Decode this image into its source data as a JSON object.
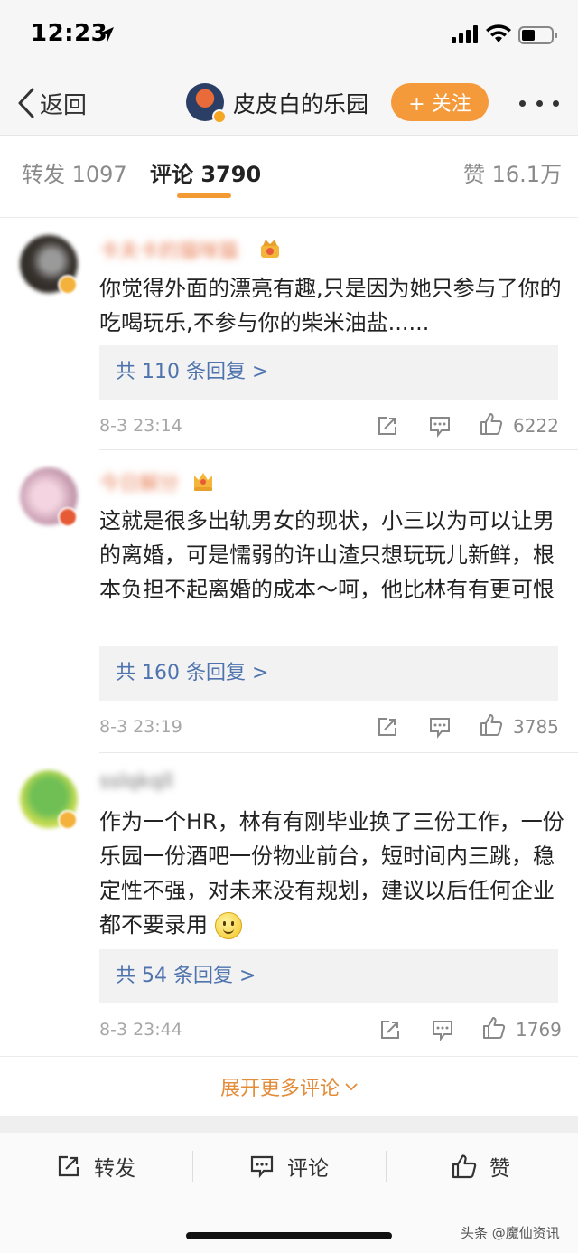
{
  "status_bar": {
    "time": "12:23"
  },
  "nav": {
    "back_label": "返回",
    "title": "皮皮白的乐园",
    "follow_label": "+ 关注"
  },
  "tabs": {
    "repost": "转发 1097",
    "comments": "评论 3790",
    "likes": "赞 16.1万"
  },
  "comments": [
    {
      "username": "卡夫卡的猫咪猫",
      "text": "你觉得外面的漂亮有趣,只是因为她只参与了你的吃喝玩乐,不参与你的柴米油盐......",
      "replies": "共 110 条回复 >",
      "time": "8-3 23:14",
      "likes": "6222"
    },
    {
      "username": "今日解分",
      "text": "这就是很多出轨男女的现状，小三以为可以让男的离婚，可是懦弱的许山渣只想玩玩儿新鲜，根本负担不起离婚的成本～呵，他比林有有更可恨",
      "replies": "共 160 条回复 >",
      "time": "8-3 23:19",
      "likes": "3785"
    },
    {
      "username": "sslqkqll",
      "text": "作为一个HR，林有有刚毕业换了三份工作，一份乐园一份酒吧一份物业前台，短时间内三跳，稳定性不强，对未来没有规划，建议以后任何企业都不要录用",
      "replies": "共 54 条回复 >",
      "time": "8-3 23:44",
      "likes": "1769"
    }
  ],
  "expand_more": "展开更多评论",
  "bottom_bar": {
    "repost": "转发",
    "comment": "评论",
    "like": "赞"
  },
  "watermark": "头条 @魔仙资讯",
  "colors": {
    "accent_orange": "#f39b32",
    "link_blue": "#4e73ad",
    "follow_bg": "#f59a3a"
  }
}
